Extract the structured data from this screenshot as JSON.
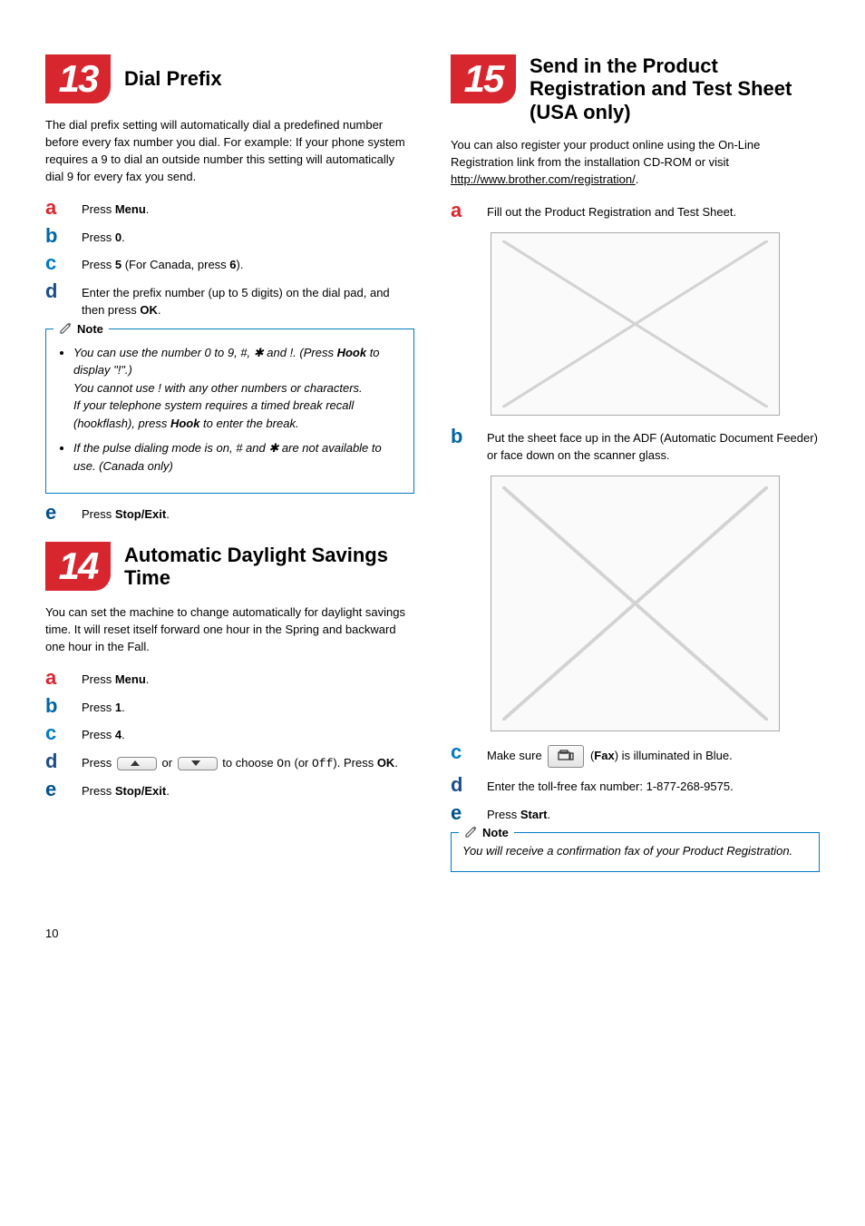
{
  "pageNumber": "10",
  "left": {
    "sec13": {
      "num": "13",
      "title": "Dial Prefix",
      "intro": "The dial prefix setting will automatically dial a predefined number before every fax number you dial. For example: If your phone system requires a 9 to dial an outside number this setting will automatically dial 9 for every fax you send.",
      "a": "Press ",
      "a_bold": "Menu",
      "a_end": ".",
      "b": "Press ",
      "b_bold": "0",
      "b_end": ".",
      "c": "Press ",
      "c_bold": "5",
      "c_mid": " (For Canada, press ",
      "c_bold2": "6",
      "c_end": ").",
      "d": "Enter the prefix number (up to 5 digits) on the dial pad, and then press ",
      "d_bold": "OK",
      "d_end": ".",
      "note_label": "Note",
      "note_b1a": "You can use the number 0 to 9, #, ",
      "note_b1b": " and !. (Press ",
      "note_b1c": "Hook",
      "note_b1d": " to display \"!\".)",
      "note_b1e": "You cannot use ! with any other numbers or characters.",
      "note_b1f": "If your telephone system requires a timed break recall (hookflash), press ",
      "note_b1g": "Hook",
      "note_b1h": " to enter the break.",
      "note_b2a": "If the pulse dialing mode is on, # and ",
      "note_b2b": " are not available to use. (Canada only)",
      "e": "Press ",
      "e_bold": "Stop/Exit",
      "e_end": "."
    },
    "sec14": {
      "num": "14",
      "title": "Automatic Daylight Savings Time",
      "intro": "You can set the machine to change automatically for daylight savings time. It will reset itself forward one hour in the Spring and backward one hour in the Fall.",
      "a": "Press ",
      "a_bold": "Menu",
      "a_end": ".",
      "b": "Press ",
      "b_bold": "1",
      "b_end": ".",
      "c": "Press ",
      "c_bold": "4",
      "c_end": ".",
      "d1": "Press ",
      "d2": " or ",
      "d3": " to choose ",
      "d_on": "On",
      "d4": " (or ",
      "d_off": "Off",
      "d5": "). Press ",
      "d_bold": "OK",
      "d_end": ".",
      "e": "Press ",
      "e_bold": "Stop/Exit",
      "e_end": "."
    }
  },
  "right": {
    "sec15": {
      "num": "15",
      "title": "Send in the Product Registration and Test Sheet (USA only)",
      "intro1": "You can also register your product online using the On-Line Registration link from the installation CD-ROM or visit ",
      "link": "http://www.brother.com/registration/",
      "intro1_end": ".",
      "a": "Fill out the Product Registration and Test Sheet.",
      "b": "Put the sheet face up in the ADF (Automatic Document Feeder) or face down on the scanner glass.",
      "c1": "Make sure ",
      "c2": " (",
      "c_bold": "Fax",
      "c3": ") is illuminated in Blue.",
      "d": "Enter the toll-free fax number: 1-877-268-9575.",
      "e": "Press ",
      "e_bold": "Start",
      "e_end": ".",
      "note_label": "Note",
      "note_body": "You will receive a confirmation fax of your Product Registration."
    }
  }
}
